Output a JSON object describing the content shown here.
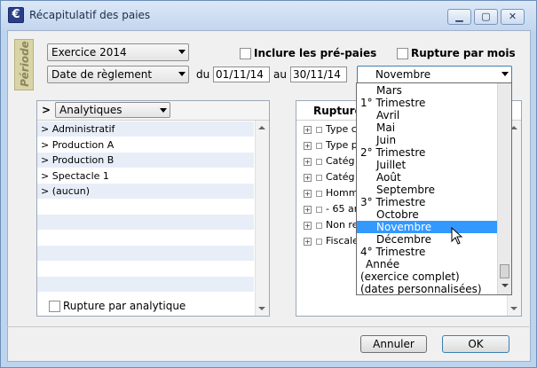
{
  "window": {
    "title": "Récapitulatif des paies"
  },
  "periode_label": "Période",
  "exercice": {
    "value": "Exercice 2014"
  },
  "date_type": {
    "value": "Date de règlement"
  },
  "inclure_prepaies": {
    "label": "Inclure les pré-paies",
    "checked": false
  },
  "rupture_mois": {
    "label": "Rupture par mois",
    "checked": false
  },
  "range": {
    "du_label": "du",
    "du_value": "01/11/14",
    "au_label": "au",
    "au_value": "30/11/14"
  },
  "period_select": {
    "value": "Novembre",
    "options": [
      "Mars",
      "1° Trimestre",
      "Avril",
      "Mai",
      "Juin",
      "2° Trimestre",
      "Juillet",
      "Août",
      "Septembre",
      "3° Trimestre",
      "Octobre",
      "Novembre",
      "Décembre",
      "4° Trimestre",
      "Année",
      "(exercice complet)",
      "(dates personnalisées)"
    ],
    "selected_index": 11
  },
  "left_panel": {
    "header_prefix": ">",
    "header_combo": "Analytiques",
    "items": [
      ">  Administratif",
      ">  Production A",
      ">  Production B",
      ">  Spectacle 1",
      ">  (aucun)"
    ],
    "rupture_label": "Rupture par analytique"
  },
  "right_panel": {
    "header": "Rupture",
    "items": [
      "Type c",
      "Type p",
      "Catég",
      "Catég",
      "Homm",
      "- 65 an",
      "Non re",
      "Fiscale"
    ]
  },
  "buttons": {
    "cancel": "Annuler",
    "ok": "OK"
  }
}
